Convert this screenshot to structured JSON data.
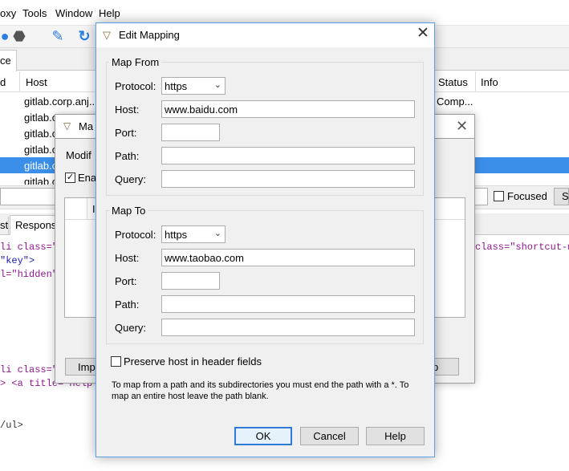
{
  "app": {
    "menu": [
      "oxy",
      "Tools",
      "Window",
      "Help"
    ],
    "tabs": {
      "sequence_tab": "ce"
    },
    "table": {
      "headers": [
        "d",
        "Host",
        "Status",
        "Info"
      ],
      "rows": [
        {
          "host": "gitlab.corp.anj...",
          "status": "Comp..."
        },
        {
          "host": "gitlab.co",
          "status": ""
        },
        {
          "host": "gitlab.co",
          "status": ""
        },
        {
          "host": "gitlab.co",
          "status": ""
        },
        {
          "host": "gitlab.co",
          "status": ""
        },
        {
          "host": "gitlab.co",
          "status": ""
        }
      ]
    },
    "filter": {
      "focused_label": "Focused",
      "settings_stub": "Se"
    },
    "subtabs": {
      "request": "st",
      "response": "Respons"
    },
    "code_lines": {
      "l1a": "li class=\"\">",
      "l1b": "class=\"shortcut-map",
      "l2": "\"key\">",
      "l3": "l=\"hidden\"",
      "l4": "li class=\"div",
      "l5": "> <a title=\"Help\" hre",
      "l6": "/ul>"
    }
  },
  "map_remote": {
    "title": "Ma",
    "modify_text": "Modif",
    "enable_text": "Ena",
    "list_col": "I",
    "import_button": "Imp",
    "right_button": "p"
  },
  "dialog": {
    "title": "Edit Mapping",
    "map_from": {
      "legend": "Map From",
      "protocol_label": "Protocol:",
      "protocol": "https",
      "host_label": "Host:",
      "host": "www.baidu.com",
      "port_label": "Port:",
      "port": "",
      "path_label": "Path:",
      "path": "",
      "query_label": "Query:",
      "query": ""
    },
    "map_to": {
      "legend": "Map To",
      "protocol_label": "Protocol:",
      "protocol": "https",
      "host_label": "Host:",
      "host": "www.taobao.com",
      "port_label": "Port:",
      "port": "",
      "path_label": "Path:",
      "path": "",
      "query_label": "Query:",
      "query": ""
    },
    "preserve_host": "Preserve host in header fields",
    "hint_line1": "To map from a path and its subdirectories you must end the path with a *. To",
    "hint_line2": "map an entire host leave the path blank.",
    "buttons": {
      "ok": "OK",
      "cancel": "Cancel",
      "help": "Help"
    }
  },
  "colors": {
    "selection": "#3b8fe8",
    "accent": "#2f7ad8",
    "tag": "#8b1a8b",
    "attr_value": "#1a1aa6"
  }
}
